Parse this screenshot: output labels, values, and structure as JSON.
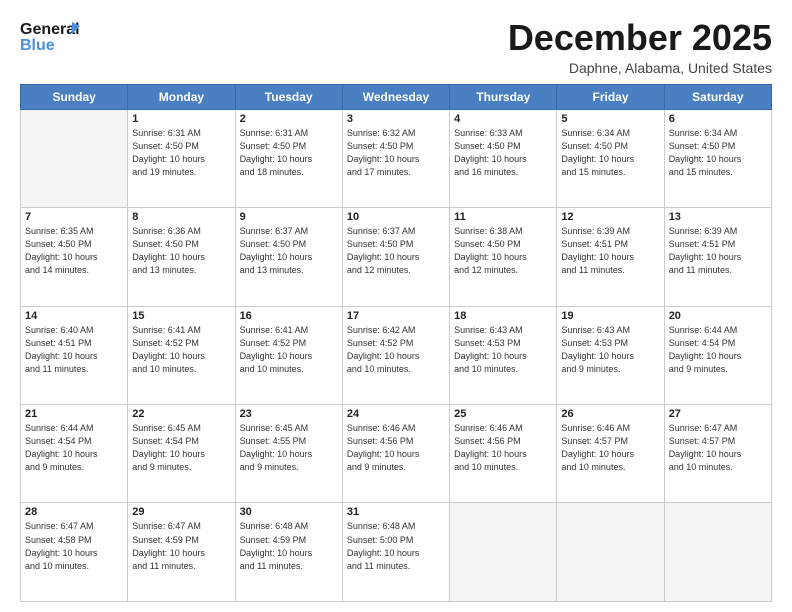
{
  "logo": {
    "line1": "General",
    "line2": "Blue"
  },
  "title": "December 2025",
  "subtitle": "Daphne, Alabama, United States",
  "days_of_week": [
    "Sunday",
    "Monday",
    "Tuesday",
    "Wednesday",
    "Thursday",
    "Friday",
    "Saturday"
  ],
  "weeks": [
    [
      {
        "day": "",
        "info": ""
      },
      {
        "day": "1",
        "info": "Sunrise: 6:31 AM\nSunset: 4:50 PM\nDaylight: 10 hours\nand 19 minutes."
      },
      {
        "day": "2",
        "info": "Sunrise: 6:31 AM\nSunset: 4:50 PM\nDaylight: 10 hours\nand 18 minutes."
      },
      {
        "day": "3",
        "info": "Sunrise: 6:32 AM\nSunset: 4:50 PM\nDaylight: 10 hours\nand 17 minutes."
      },
      {
        "day": "4",
        "info": "Sunrise: 6:33 AM\nSunset: 4:50 PM\nDaylight: 10 hours\nand 16 minutes."
      },
      {
        "day": "5",
        "info": "Sunrise: 6:34 AM\nSunset: 4:50 PM\nDaylight: 10 hours\nand 15 minutes."
      },
      {
        "day": "6",
        "info": "Sunrise: 6:34 AM\nSunset: 4:50 PM\nDaylight: 10 hours\nand 15 minutes."
      }
    ],
    [
      {
        "day": "7",
        "info": "Sunrise: 6:35 AM\nSunset: 4:50 PM\nDaylight: 10 hours\nand 14 minutes."
      },
      {
        "day": "8",
        "info": "Sunrise: 6:36 AM\nSunset: 4:50 PM\nDaylight: 10 hours\nand 13 minutes."
      },
      {
        "day": "9",
        "info": "Sunrise: 6:37 AM\nSunset: 4:50 PM\nDaylight: 10 hours\nand 13 minutes."
      },
      {
        "day": "10",
        "info": "Sunrise: 6:37 AM\nSunset: 4:50 PM\nDaylight: 10 hours\nand 12 minutes."
      },
      {
        "day": "11",
        "info": "Sunrise: 6:38 AM\nSunset: 4:50 PM\nDaylight: 10 hours\nand 12 minutes."
      },
      {
        "day": "12",
        "info": "Sunrise: 6:39 AM\nSunset: 4:51 PM\nDaylight: 10 hours\nand 11 minutes."
      },
      {
        "day": "13",
        "info": "Sunrise: 6:39 AM\nSunset: 4:51 PM\nDaylight: 10 hours\nand 11 minutes."
      }
    ],
    [
      {
        "day": "14",
        "info": "Sunrise: 6:40 AM\nSunset: 4:51 PM\nDaylight: 10 hours\nand 11 minutes."
      },
      {
        "day": "15",
        "info": "Sunrise: 6:41 AM\nSunset: 4:52 PM\nDaylight: 10 hours\nand 10 minutes."
      },
      {
        "day": "16",
        "info": "Sunrise: 6:41 AM\nSunset: 4:52 PM\nDaylight: 10 hours\nand 10 minutes."
      },
      {
        "day": "17",
        "info": "Sunrise: 6:42 AM\nSunset: 4:52 PM\nDaylight: 10 hours\nand 10 minutes."
      },
      {
        "day": "18",
        "info": "Sunrise: 6:43 AM\nSunset: 4:53 PM\nDaylight: 10 hours\nand 10 minutes."
      },
      {
        "day": "19",
        "info": "Sunrise: 6:43 AM\nSunset: 4:53 PM\nDaylight: 10 hours\nand 9 minutes."
      },
      {
        "day": "20",
        "info": "Sunrise: 6:44 AM\nSunset: 4:54 PM\nDaylight: 10 hours\nand 9 minutes."
      }
    ],
    [
      {
        "day": "21",
        "info": "Sunrise: 6:44 AM\nSunset: 4:54 PM\nDaylight: 10 hours\nand 9 minutes."
      },
      {
        "day": "22",
        "info": "Sunrise: 6:45 AM\nSunset: 4:54 PM\nDaylight: 10 hours\nand 9 minutes."
      },
      {
        "day": "23",
        "info": "Sunrise: 6:45 AM\nSunset: 4:55 PM\nDaylight: 10 hours\nand 9 minutes."
      },
      {
        "day": "24",
        "info": "Sunrise: 6:46 AM\nSunset: 4:56 PM\nDaylight: 10 hours\nand 9 minutes."
      },
      {
        "day": "25",
        "info": "Sunrise: 6:46 AM\nSunset: 4:56 PM\nDaylight: 10 hours\nand 10 minutes."
      },
      {
        "day": "26",
        "info": "Sunrise: 6:46 AM\nSunset: 4:57 PM\nDaylight: 10 hours\nand 10 minutes."
      },
      {
        "day": "27",
        "info": "Sunrise: 6:47 AM\nSunset: 4:57 PM\nDaylight: 10 hours\nand 10 minutes."
      }
    ],
    [
      {
        "day": "28",
        "info": "Sunrise: 6:47 AM\nSunset: 4:58 PM\nDaylight: 10 hours\nand 10 minutes."
      },
      {
        "day": "29",
        "info": "Sunrise: 6:47 AM\nSunset: 4:59 PM\nDaylight: 10 hours\nand 11 minutes."
      },
      {
        "day": "30",
        "info": "Sunrise: 6:48 AM\nSunset: 4:59 PM\nDaylight: 10 hours\nand 11 minutes."
      },
      {
        "day": "31",
        "info": "Sunrise: 6:48 AM\nSunset: 5:00 PM\nDaylight: 10 hours\nand 11 minutes."
      },
      {
        "day": "",
        "info": ""
      },
      {
        "day": "",
        "info": ""
      },
      {
        "day": "",
        "info": ""
      }
    ]
  ]
}
